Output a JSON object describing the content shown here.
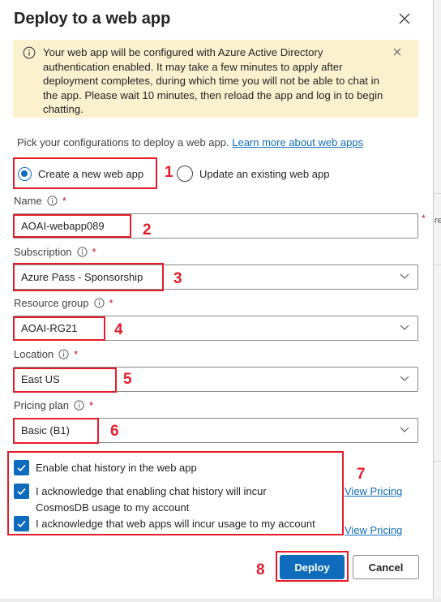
{
  "dialog": {
    "title": "Deploy to a web app",
    "close_icon": "close-icon"
  },
  "banner": {
    "icon": "info-icon",
    "text": "Your web app will be configured with Azure Active Directory authentication enabled. It may take a few minutes to apply after deployment completes, during which time you will not be able to chat in the app. Please wait 10 minutes, then reload the app and log in to begin chatting.",
    "dismiss_icon": "close-icon"
  },
  "intro": {
    "text": "Pick your configurations to deploy a web app.",
    "link": "Learn more about web apps"
  },
  "mode": {
    "options": [
      {
        "label": "Create a new web app",
        "selected": true
      },
      {
        "label": "Update an existing web app",
        "selected": false
      }
    ]
  },
  "fields": {
    "name": {
      "label": "Name",
      "value": "AOAI-webapp089",
      "required": "*"
    },
    "subscription": {
      "label": "Subscription",
      "value": "Azure Pass - Sponsorship",
      "required": "*"
    },
    "resource_group": {
      "label": "Resource group",
      "value": "AOAI-RG21",
      "required": "*"
    },
    "location": {
      "label": "Location",
      "value": "East US",
      "required": "*"
    },
    "pricing_plan": {
      "label": "Pricing plan",
      "value": "Basic (B1)",
      "required": "*"
    }
  },
  "checkboxes": [
    {
      "label": "Enable chat history in the web app",
      "checked": true
    },
    {
      "label_line1": "I acknowledge that enabling chat history will incur",
      "label_line2": "CosmosDB usage to my account",
      "checked": true
    },
    {
      "label": "I acknowledge that web apps will incur usage to my account",
      "checked": true
    }
  ],
  "links": {
    "view_pricing_1": "View Pricing",
    "view_pricing_2": "View Pricing"
  },
  "buttons": {
    "deploy": "Deploy",
    "cancel": "Cancel"
  },
  "annotations": [
    "1",
    "2",
    "3",
    "4",
    "5",
    "6",
    "7",
    "8"
  ],
  "background": {
    "fragment": "re",
    "asterisk": "*"
  },
  "colors": {
    "accent": "#0f6cbd",
    "banner_bg": "#fcf1cf",
    "callout": "#e41d2b",
    "required": "#c50f1f"
  }
}
